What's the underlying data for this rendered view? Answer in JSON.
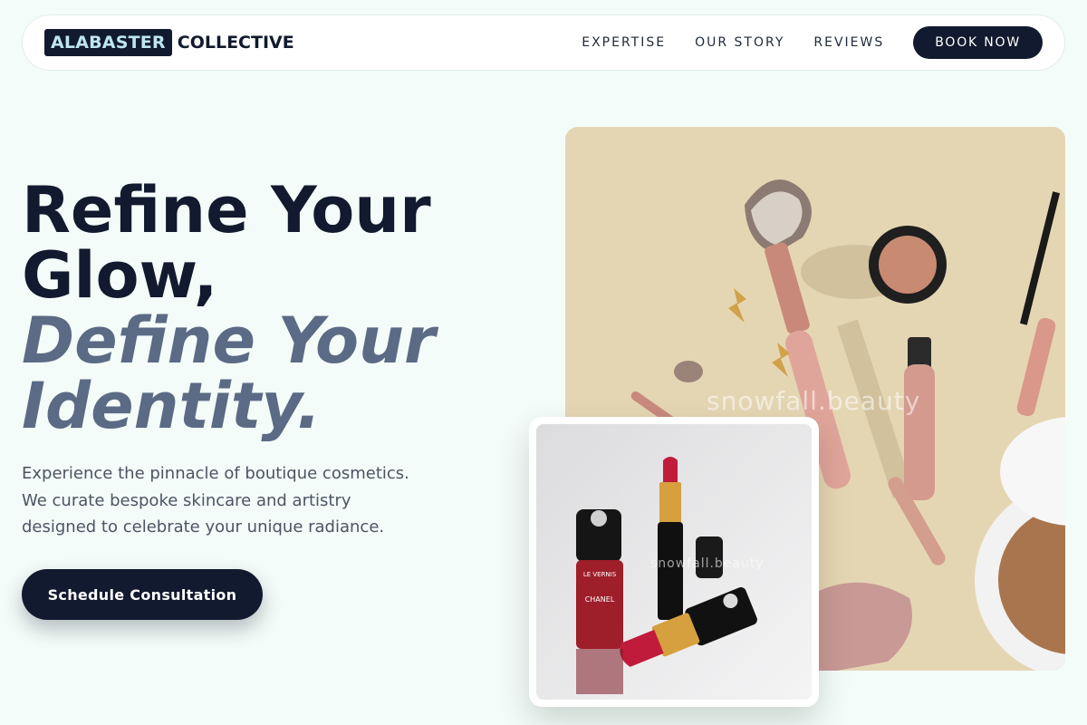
{
  "brand": {
    "boxed": "ALABASTER",
    "rest": "COLLECTIVE"
  },
  "nav": {
    "links": [
      "EXPERTISE",
      "OUR STORY",
      "REVIEWS"
    ],
    "cta": "BOOK NOW"
  },
  "hero": {
    "headline_line1": "Refine Your Glow,",
    "headline_line2": "Define Your Identity.",
    "subtext": "Experience the pinnacle of boutique cosmetics. We curate bespoke skincare and artistry designed to celebrate your unique radiance.",
    "cta": "Schedule Consultation"
  },
  "images": {
    "main_watermark": "snowfall.beauty",
    "inset_watermark": "snowfall.beauty",
    "lipstick_bottle_text": "CHANEL",
    "polish_label": "LE VERNIS"
  },
  "colors": {
    "background": "#f3fcf8",
    "navy": "#111a2e",
    "slate": "#5b6a85",
    "logo_accent": "#bfe6f0",
    "main_image_bg": "#e5d6b3"
  },
  "icons": [
    "brush-icon",
    "compact-icon",
    "mascara-icon",
    "lipstick-icon"
  ]
}
